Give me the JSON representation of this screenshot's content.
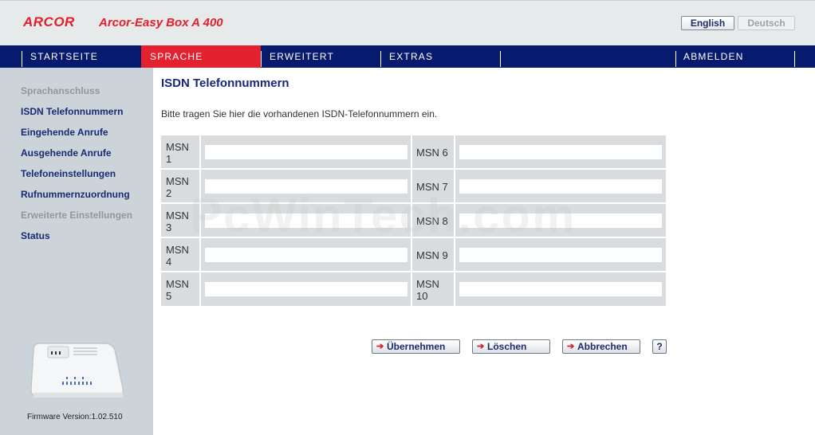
{
  "header": {
    "brand_logo": "ARCOR",
    "product_name": "Arcor-Easy Box A 400",
    "lang_english": "English",
    "lang_deutsch": "Deutsch"
  },
  "nav": {
    "items": [
      "STARTSEITE",
      "SPRACHE",
      "ERWEITERT",
      "EXTRAS",
      "ABMELDEN"
    ],
    "active": "SPRACHE"
  },
  "sidebar": {
    "items": [
      {
        "label": "Sprachanschluss",
        "state": "disabled"
      },
      {
        "label": "ISDN Telefonnummern",
        "state": "active"
      },
      {
        "label": "Eingehende Anrufe",
        "state": "enabled"
      },
      {
        "label": "Ausgehende Anrufe",
        "state": "enabled"
      },
      {
        "label": "Telefoneinstellungen",
        "state": "enabled"
      },
      {
        "label": "Rufnummernzuordnung",
        "state": "enabled"
      },
      {
        "label": "Erweiterte Einstellungen",
        "state": "disabled"
      },
      {
        "label": "Status",
        "state": "enabled"
      }
    ],
    "firmware": "Firmware Version:1.02.510"
  },
  "main": {
    "title": "ISDN Telefonnummern",
    "intro": "Bitte tragen Sie hier die vorhandenen ISDN-Telefonnummern ein.",
    "msn_rows": [
      {
        "left_label": "MSN 1",
        "left_value": "",
        "right_label": "MSN 6",
        "right_value": ""
      },
      {
        "left_label": "MSN 2",
        "left_value": "",
        "right_label": "MSN 7",
        "right_value": ""
      },
      {
        "left_label": "MSN 3",
        "left_value": "",
        "right_label": "MSN 8",
        "right_value": ""
      },
      {
        "left_label": "MSN 4",
        "left_value": "",
        "right_label": "MSN 9",
        "right_value": ""
      },
      {
        "left_label": "MSN 5",
        "left_value": "",
        "right_label": "MSN 10",
        "right_value": ""
      }
    ],
    "buttons": {
      "apply": "Übernehmen",
      "clear": "Löschen",
      "cancel": "Abbrechen",
      "help": "?"
    }
  },
  "watermark": "PcWinTech.com",
  "colors": {
    "nav_bg": "#071b6e",
    "nav_active": "#e3212f",
    "sidebar_bg": "#cdd4d9",
    "title": "#17287a"
  }
}
